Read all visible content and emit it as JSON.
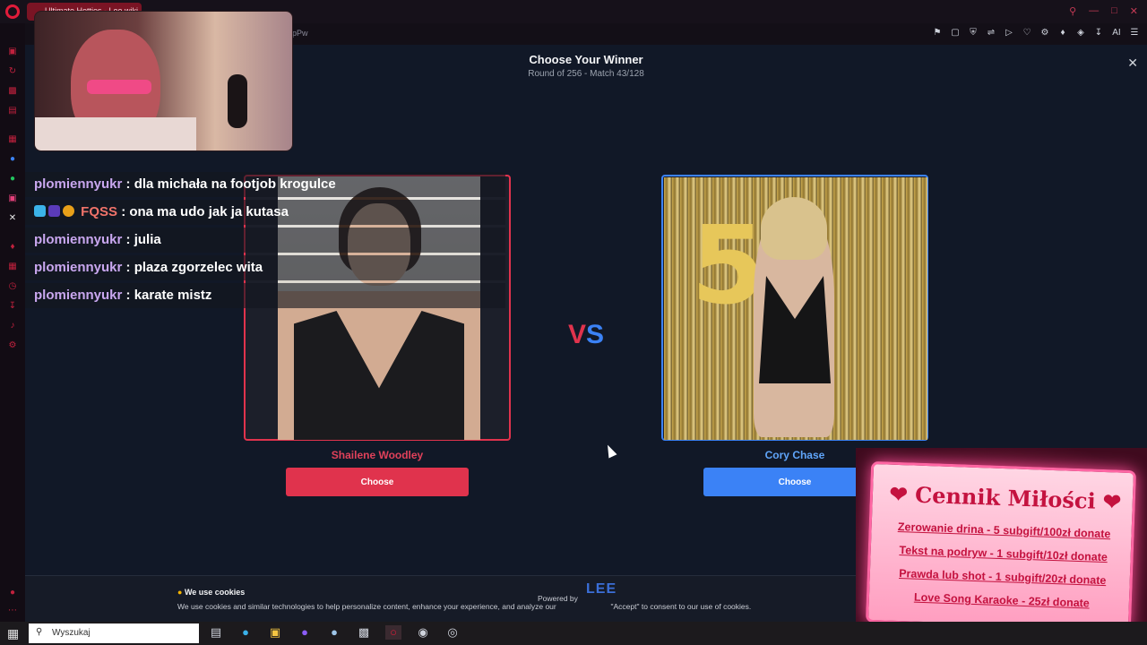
{
  "browser": {
    "tab_title": "Ultimate Hotties - Lee.wiki",
    "url": "pPw",
    "ai_label": "AI"
  },
  "page": {
    "title": "Choose Your Winner",
    "subtitle": "Round of 256 - Match 43/128",
    "vs_v": "V",
    "vs_s": "S",
    "left": {
      "name": "Shailene Woodley",
      "button": "Choose"
    },
    "right": {
      "name": "Cory Chase",
      "button": "Choose"
    }
  },
  "cookies": {
    "title": "We use cookies",
    "text": "We use cookies and similar technologies to help personalize content, enhance your experience, and analyze our",
    "text_end": "\"Accept\" to consent to our use of cookies.",
    "powered": "Powered by",
    "logo": "LEE"
  },
  "chat": [
    {
      "user": "plomiennyukr",
      "msg": ": dla michała na footjob krogulce",
      "red": false
    },
    {
      "user": "FQSS",
      "msg": ": ona ma udo jak ja kutasa",
      "red": true
    },
    {
      "user": "plomiennyukr",
      "msg": ": julia",
      "red": false
    },
    {
      "user": "plomiennyukr",
      "msg": ": plaza zgorzelec wita",
      "red": false
    },
    {
      "user": "plomiennyukr",
      "msg": ": karate mistz",
      "red": false
    }
  ],
  "cennik": {
    "title": "Cennik Miłości",
    "lines": [
      "Zerowanie drina - 5 subgift/100zł donate",
      "Tekst na podryw - 1 subgift/10zł donate",
      "Prawda lub shot - 1 subgift/20zł donate",
      "Love Song Karaoke - 25zł donate"
    ]
  },
  "taskbar": {
    "search_placeholder": "Wyszukaj"
  },
  "colors": {
    "left_accent": "#e0334d",
    "right_accent": "#3b82f6",
    "background": "#111827"
  }
}
